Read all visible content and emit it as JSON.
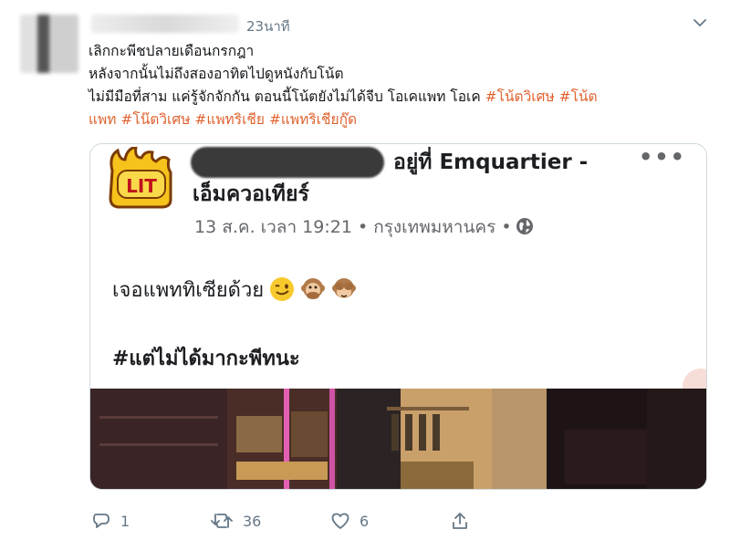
{
  "tweet": {
    "time": "23นาที",
    "lines": [
      {
        "text": "เลิกกะพีชปลายเดือนกรกฎา"
      },
      {
        "text": "หลังจากนั้นไม่ถึงสองอาทิตไปดูหนังกับโน้ต"
      },
      {
        "text": "ไม่มีมือที่สาม แค่รู้จักจักกัน ตอนนี้โน้ตยังไม่ได้จีบ โอเคแพท โอเค ",
        "tags": [
          "#โน้ตวิเศษ",
          "#โน้ต"
        ]
      },
      {
        "text": "",
        "tags": [
          "แพท",
          "#โน๊ตวิเศษ",
          "#แพทริเชีย",
          "#แพทริเชียกู๊ด"
        ]
      }
    ]
  },
  "card": {
    "badge": "LIT",
    "place_prefix": "อยู่ที่ Emquartier -",
    "place_suffix": "เอ็มควอเทียร์",
    "meta": "13 ส.ค. เวลา 19:21 • กรุงเทพมหานคร •",
    "more": "•••",
    "body_text": "เจอแพททิเซียด้วย",
    "hashtag_text": "#แต่ไม่ได้มากะพีทนะ"
  },
  "actions": {
    "reply_count": "1",
    "retweet_count": "36",
    "like_count": "6"
  },
  "icons": [
    "caret-down-icon",
    "globe-icon",
    "reply-icon",
    "retweet-icon",
    "like-icon",
    "share-icon"
  ],
  "colors": {
    "hashtag": "#e0622f",
    "muted": "#657786",
    "card_border": "#cfd9de"
  }
}
